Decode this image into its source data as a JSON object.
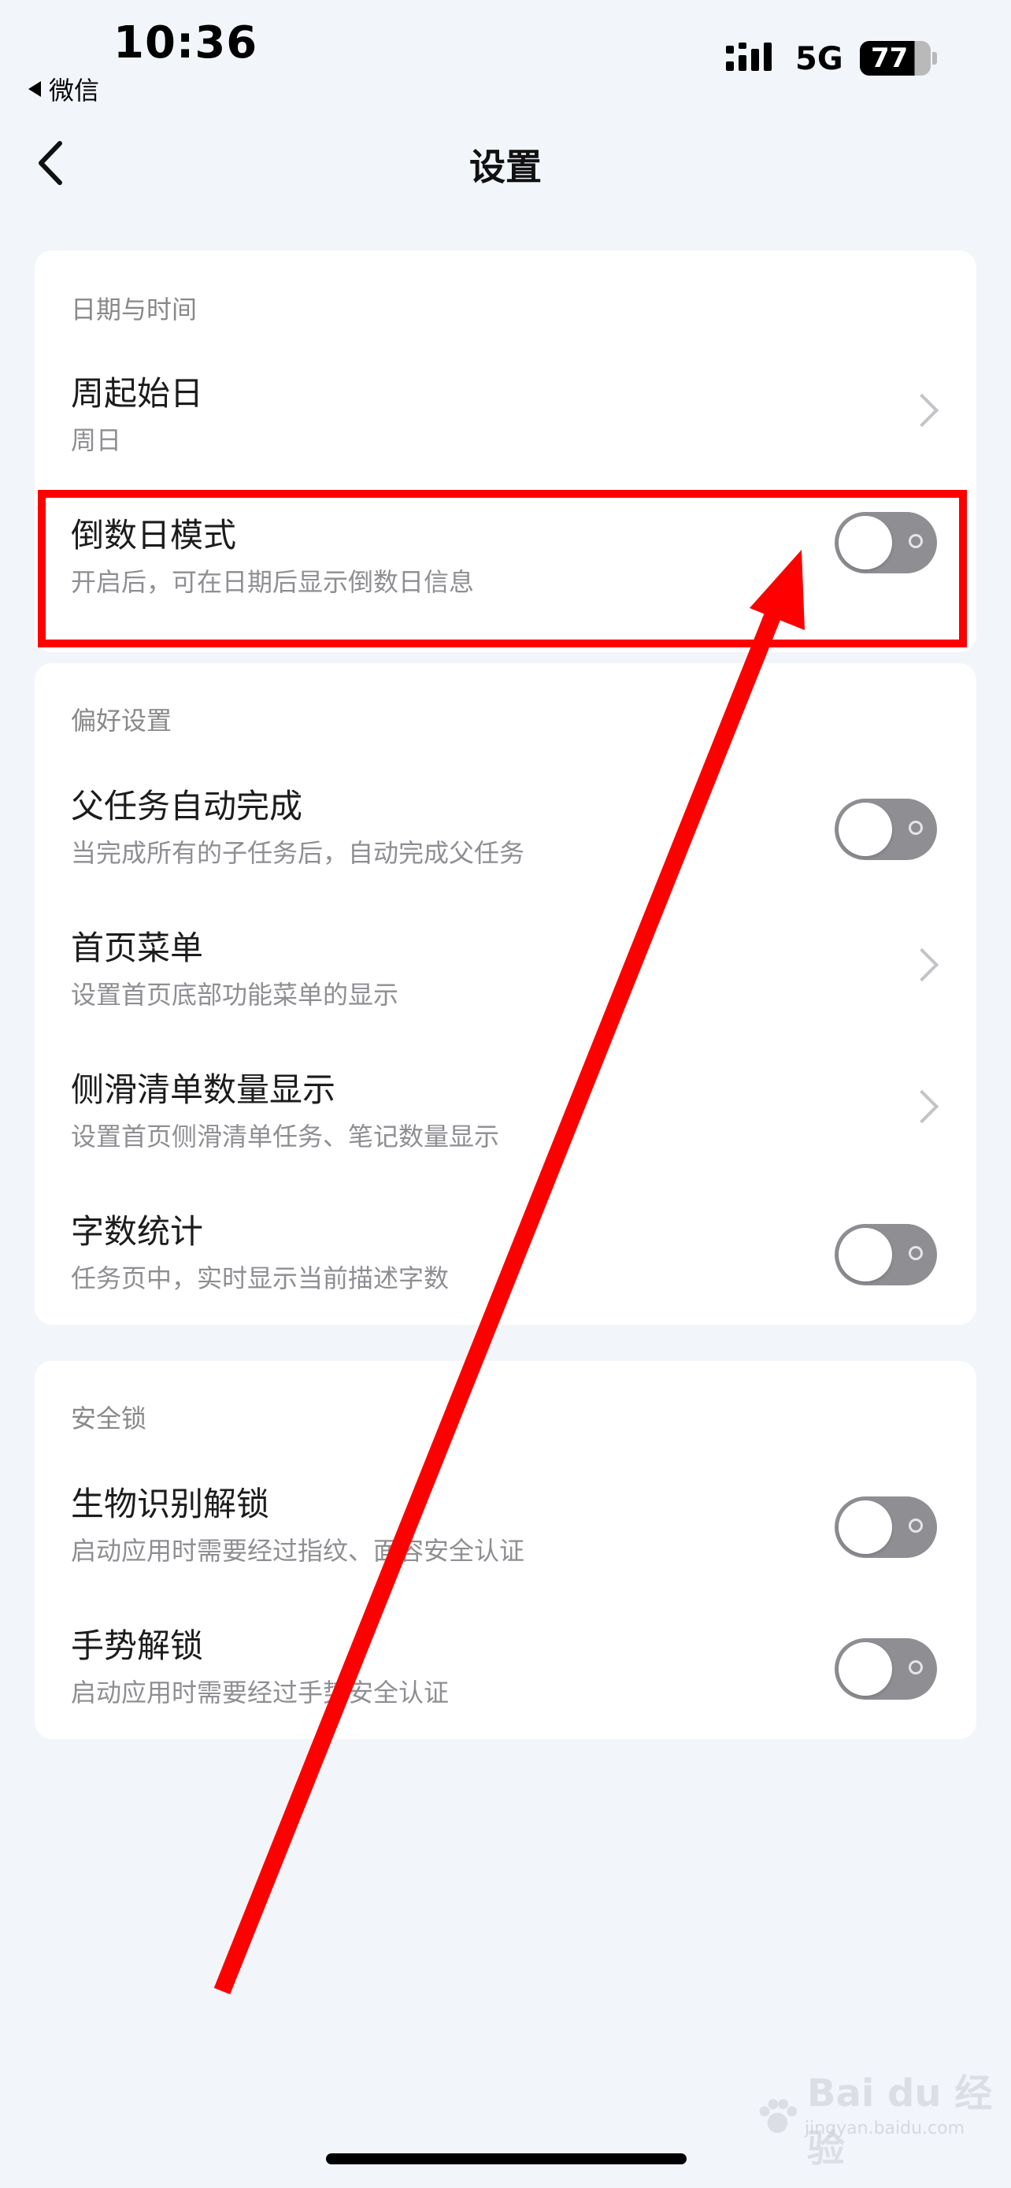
{
  "status_bar": {
    "time": "10:36",
    "back_app": "微信",
    "network": "5G",
    "battery": "77",
    "battery_level": 0.77
  },
  "nav": {
    "title": "设置"
  },
  "sections": [
    {
      "header": "日期与时间",
      "rows": [
        {
          "title": "周起始日",
          "subtitle": "周日",
          "control": "chevron"
        },
        {
          "title": "倒数日模式",
          "subtitle": "开启后，可在日期后显示倒数日信息",
          "control": "toggle",
          "on": false
        }
      ]
    },
    {
      "header": "偏好设置",
      "rows": [
        {
          "title": "父任务自动完成",
          "subtitle": "当完成所有的子任务后，自动完成父任务",
          "control": "toggle",
          "on": false
        },
        {
          "title": "首页菜单",
          "subtitle": "设置首页底部功能菜单的显示",
          "control": "chevron"
        },
        {
          "title": "侧滑清单数量显示",
          "subtitle": "设置首页侧滑清单任务、笔记数量显示",
          "control": "chevron"
        },
        {
          "title": "字数统计",
          "subtitle": "任务页中，实时显示当前描述字数",
          "control": "toggle",
          "on": false
        }
      ]
    },
    {
      "header": "安全锁",
      "rows": [
        {
          "title": "生物识别解锁",
          "subtitle": "启动应用时需要经过指纹、面容安全认证",
          "control": "toggle",
          "on": false
        },
        {
          "title": "手势解锁",
          "subtitle": "启动应用时需要经过手势安全认证",
          "control": "toggle",
          "on": false
        }
      ]
    }
  ],
  "watermark": {
    "text": "Bai du 经验",
    "sub": "jingyan.baidu.com"
  },
  "colors": {
    "background": "#f2f5fa",
    "card": "#ffffff",
    "toggle_off": "#8e8e93",
    "annotation": "#ff0000"
  }
}
